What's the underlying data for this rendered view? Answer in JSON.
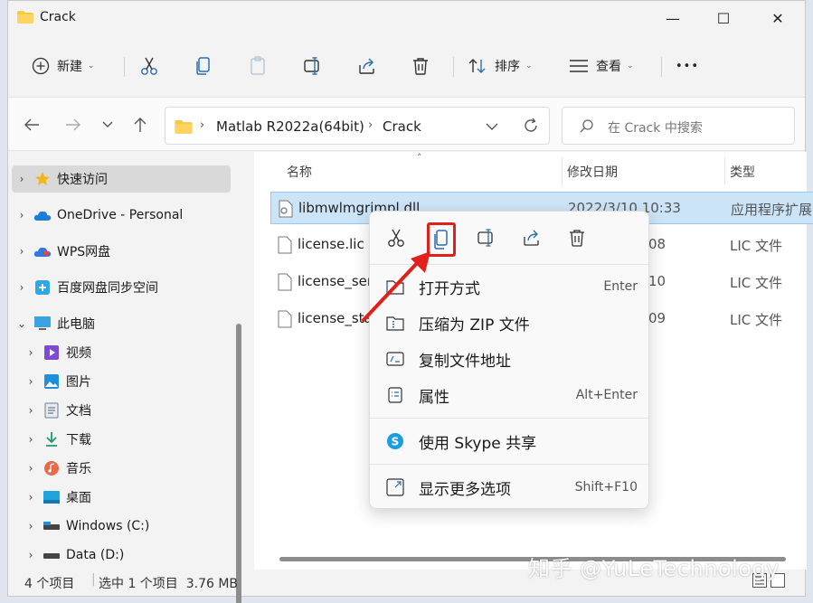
{
  "window": {
    "title": "Crack"
  },
  "window_controls": {
    "minimize": "—",
    "maximize": "☐",
    "close": "✕"
  },
  "toolbar": {
    "new_label": "新建",
    "sort_label": "排序",
    "view_label": "查看",
    "more_label": "•••"
  },
  "address": {
    "segments": [
      "Matlab R2022a(64bit)",
      "Crack"
    ],
    "separator": "›"
  },
  "search": {
    "placeholder": "在 Crack 中搜索"
  },
  "sidebar": {
    "items": [
      {
        "label": "快速访问",
        "icon": "star-icon",
        "level": 0,
        "selected": true
      },
      {
        "label": "OneDrive - Personal",
        "icon": "cloud-icon",
        "level": 0
      },
      {
        "label": "WPS网盘",
        "icon": "wps-cloud-icon",
        "level": 0
      },
      {
        "label": "百度网盘同步空间",
        "icon": "baidu-sync-icon",
        "level": 0
      },
      {
        "label": "此电脑",
        "icon": "computer-icon",
        "level": 0,
        "expanded": true
      },
      {
        "label": "视频",
        "icon": "video-icon",
        "level": 1
      },
      {
        "label": "图片",
        "icon": "picture-icon",
        "level": 1
      },
      {
        "label": "文档",
        "icon": "document-icon",
        "level": 1
      },
      {
        "label": "下载",
        "icon": "download-icon",
        "level": 1
      },
      {
        "label": "音乐",
        "icon": "music-icon",
        "level": 1
      },
      {
        "label": "桌面",
        "icon": "desktop-icon",
        "level": 1
      },
      {
        "label": "Windows (C:)",
        "icon": "drive-icon",
        "level": 1
      },
      {
        "label": "Data (D:)",
        "icon": "drive-icon",
        "level": 1
      }
    ]
  },
  "columns": {
    "name": "名称",
    "date": "修改日期",
    "type": "类型"
  },
  "files": [
    {
      "name": "libmwlmgrimpl.dll",
      "date": "2022/3/10 10:33",
      "type": "应用程序扩展",
      "selected": true
    },
    {
      "name": "license.lic",
      "date": "08",
      "type": "LIC 文件"
    },
    {
      "name": "license_ser",
      "date": "10",
      "type": "LIC 文件"
    },
    {
      "name": "license_sta",
      "date": "09",
      "type": "LIC 文件"
    }
  ],
  "status": {
    "count": "4 个项目",
    "selection": "选中 1 个项目  3.76 MB"
  },
  "context_menu": {
    "items": [
      {
        "label": "打开方式",
        "shortcut": "Enter",
        "icon": "open-with-icon"
      },
      {
        "label": "压缩为 ZIP 文件",
        "shortcut": "",
        "icon": "zip-icon"
      },
      {
        "label": "复制文件地址",
        "shortcut": "",
        "icon": "copy-path-icon"
      },
      {
        "label": "属性",
        "shortcut": "Alt+Enter",
        "icon": "properties-icon"
      },
      {
        "label": "使用 Skype 共享",
        "shortcut": "",
        "icon": "skype-icon"
      },
      {
        "label": "显示更多选项",
        "shortcut": "Shift+F10",
        "icon": "more-options-icon"
      }
    ]
  },
  "watermark": "知乎 @YuLeTechnology",
  "colors": {
    "selection": "#cce4f7",
    "highlight": "#e0201b",
    "accent": "#0067c0"
  }
}
